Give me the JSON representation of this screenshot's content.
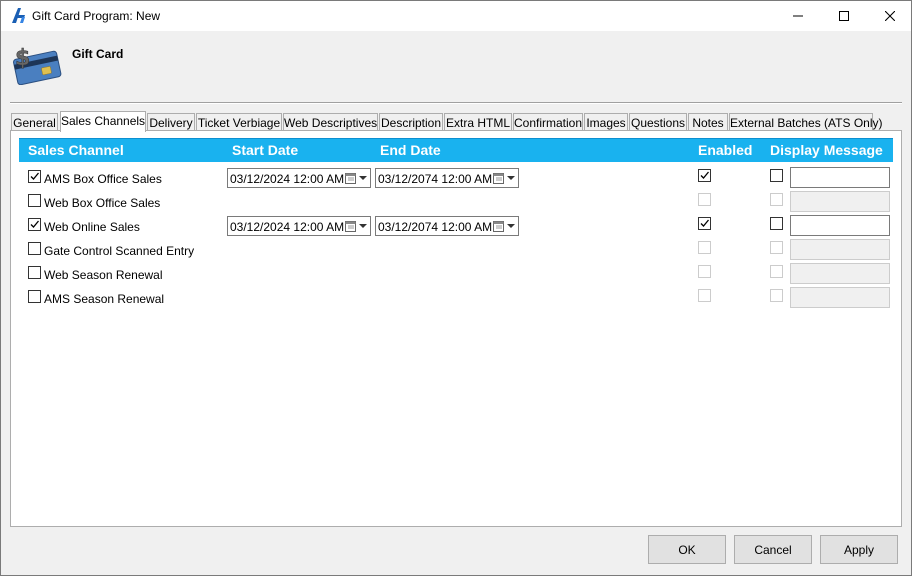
{
  "window": {
    "title": "Gift Card Program: New"
  },
  "header": {
    "title": "Gift Card"
  },
  "tabs": [
    {
      "label": "General",
      "active": false
    },
    {
      "label": "Sales Channels",
      "active": true
    },
    {
      "label": "Delivery",
      "active": false
    },
    {
      "label": "Ticket Verbiage",
      "active": false
    },
    {
      "label": "Web Descriptives",
      "active": false
    },
    {
      "label": "Description",
      "active": false
    },
    {
      "label": "Extra HTML",
      "active": false
    },
    {
      "label": "Confirmation",
      "active": false
    },
    {
      "label": "Images",
      "active": false
    },
    {
      "label": "Questions",
      "active": false
    },
    {
      "label": "Notes",
      "active": false
    },
    {
      "label": "External Batches (ATS Only)",
      "active": false
    }
  ],
  "grid": {
    "columns": {
      "channel": "Sales Channel",
      "start": "Start Date",
      "end": "End Date",
      "enabled": "Enabled",
      "display": "Display Message"
    },
    "header_color": "#19b2ef",
    "rows": [
      {
        "label": "AMS Box Office Sales",
        "checked": true,
        "start": "03/12/2024 12:00 AM",
        "end": "03/12/2074 12:00 AM",
        "enabled": true,
        "display_message": false,
        "message": ""
      },
      {
        "label": "Web Box Office Sales",
        "checked": false,
        "enabled": false,
        "display_message": false,
        "message": ""
      },
      {
        "label": "Web Online Sales",
        "checked": true,
        "start": "03/12/2024 12:00 AM",
        "end": "03/12/2074 12:00 AM",
        "enabled": true,
        "display_message": false,
        "message": ""
      },
      {
        "label": "Gate Control Scanned Entry",
        "checked": false,
        "enabled": false,
        "display_message": false,
        "message": ""
      },
      {
        "label": "Web Season Renewal",
        "checked": false,
        "enabled": false,
        "display_message": false,
        "message": ""
      },
      {
        "label": "AMS Season Renewal",
        "checked": false,
        "enabled": false,
        "display_message": false,
        "message": ""
      }
    ]
  },
  "footer": {
    "ok": "OK",
    "cancel": "Cancel",
    "apply": "Apply"
  }
}
